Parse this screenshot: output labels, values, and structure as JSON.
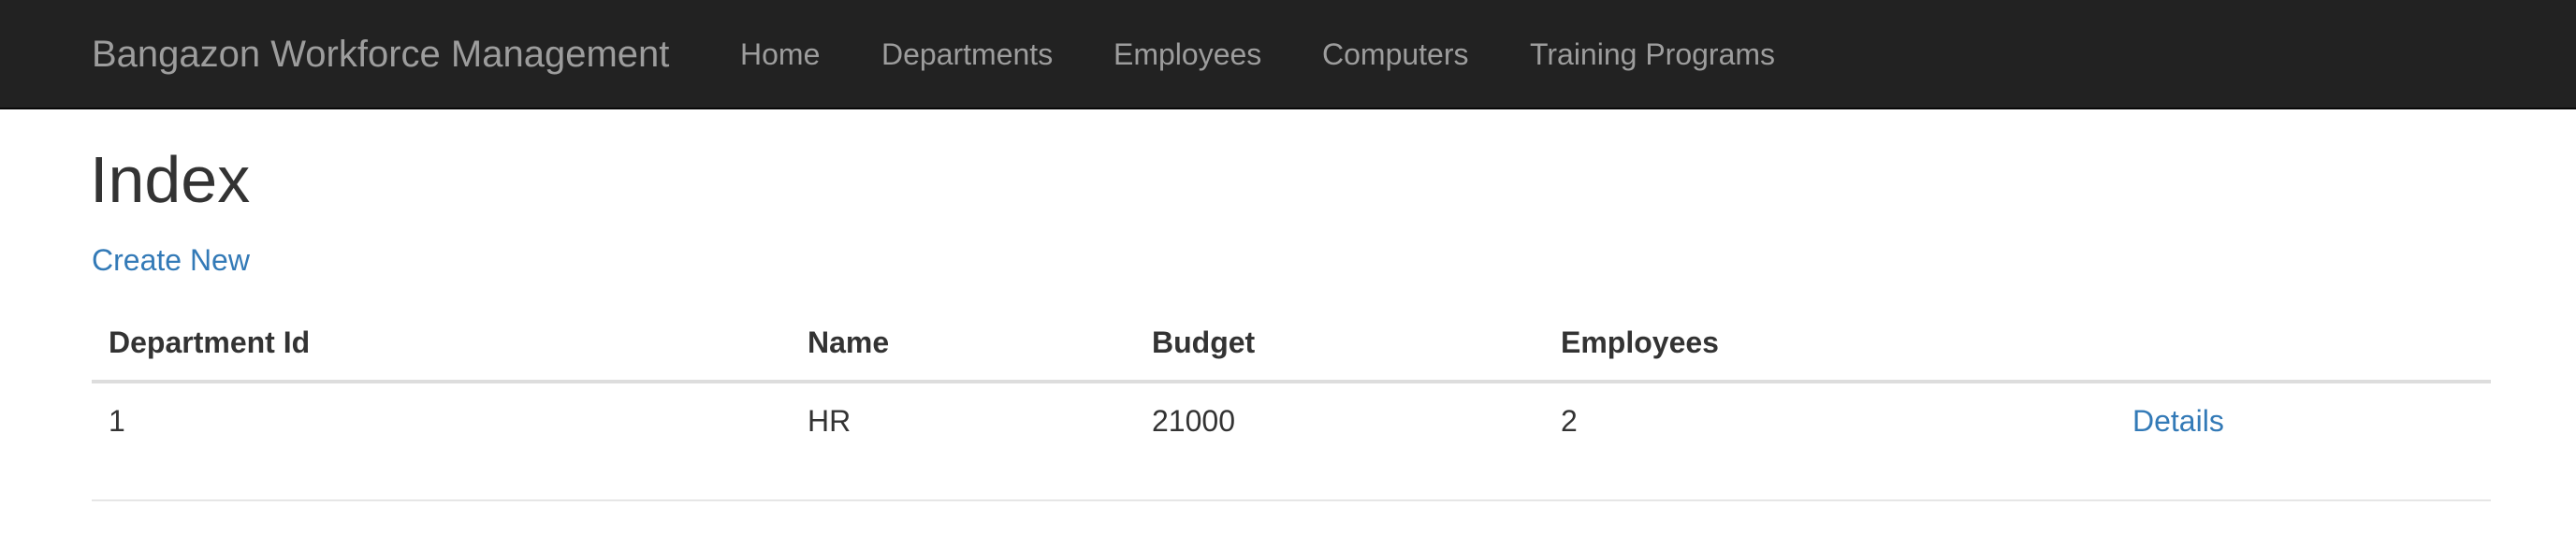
{
  "navbar": {
    "brand": "Bangazon Workforce Management",
    "links": [
      "Home",
      "Departments",
      "Employees",
      "Computers",
      "Training Programs"
    ]
  },
  "page": {
    "title": "Index",
    "create_link": "Create New"
  },
  "table": {
    "headers": [
      "Department Id",
      "Name",
      "Budget",
      "Employees",
      ""
    ],
    "rows": [
      [
        "1",
        "HR",
        "21000",
        "2",
        "Details"
      ]
    ]
  },
  "colors": {
    "navbar_bg": "#222222",
    "nav_text": "#9d9d9d",
    "link": "#337ab7",
    "text": "#333333"
  }
}
